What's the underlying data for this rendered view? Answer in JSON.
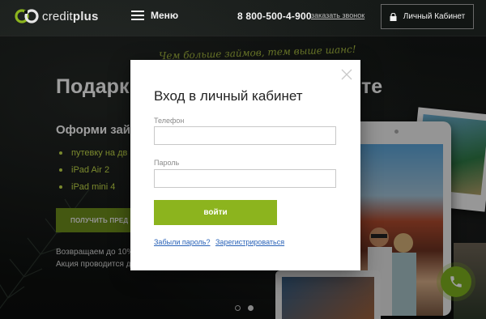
{
  "header": {
    "logo_word_light": "credit",
    "logo_word_bold": "plus",
    "menu_label": "Меню",
    "phone": "8 800-500-4-900",
    "callback_link": "заказать звонок",
    "cabinet_button": "Личный Кабинет"
  },
  "hero": {
    "slogan": "Чем больше займов, тем выше шанс!",
    "title_start": "Подарк",
    "title_end": "те",
    "subtitle": "Оформи займ",
    "prizes": [
      "путевку на дв",
      "iPad Air 2",
      "iPad mini 4"
    ],
    "cta": "ПОЛУЧИТЬ ПРЕД",
    "note_line1": "Возвращаем до 10%",
    "note_line2": "Акция проводится д"
  },
  "modal": {
    "title": "Вход в личный кабинет",
    "phone_label": "Телефон",
    "phone_value": "",
    "password_label": "Пароль",
    "password_value": "",
    "login_button": "войти",
    "forgot_link": "Забыли пароль?",
    "register_link": "Зарегистрироваться"
  },
  "colors": {
    "accent_green": "#8cb41e",
    "slogan_lime": "#c6dd4a",
    "link_blue": "#2a63b8"
  },
  "icons": [
    "logo-mark-icon",
    "menu-burger-icon",
    "lock-icon",
    "close-icon",
    "phone-call-icon"
  ]
}
